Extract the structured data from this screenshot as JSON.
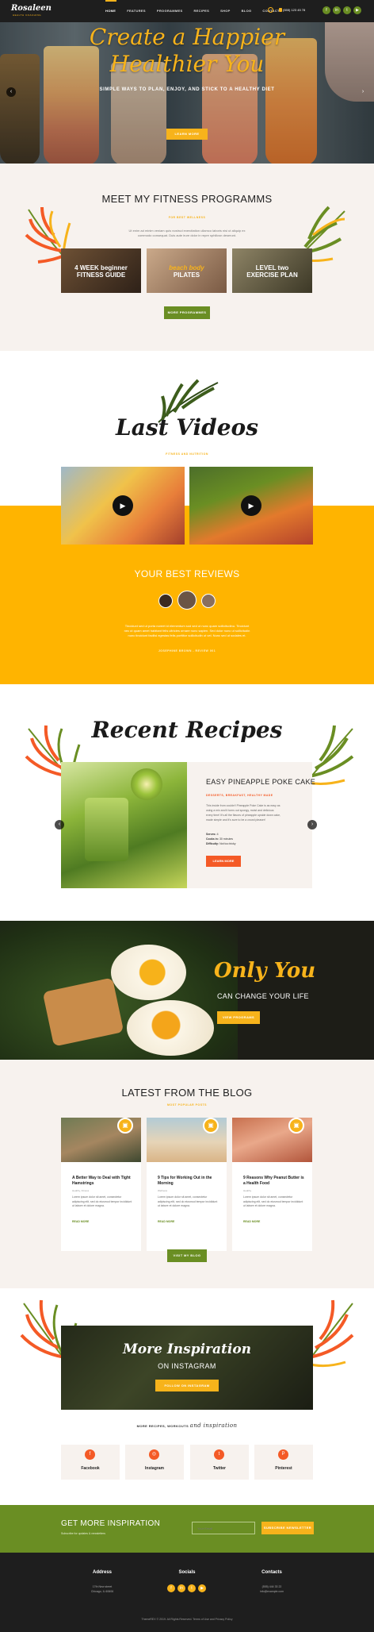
{
  "header": {
    "logo": "Rosaleen",
    "logo_sub": "HEALTH COACHING",
    "nav": [
      "HOME",
      "FEATURES",
      "PROGRAMMES",
      "RECIPES",
      "SHOP",
      "BLOG",
      "CONTACTS"
    ],
    "phone": "(555) 123 45 78",
    "socials": [
      "f",
      "in",
      "t",
      "▶"
    ]
  },
  "hero": {
    "title_line1": "Create a Happier",
    "title_line2": "Healthier You",
    "subtitle": "SIMPLE WAYS TO PLAN, ENJOY, AND STICK TO A HEALTHY DIET",
    "button": "LEARN MORE"
  },
  "programs": {
    "title": "MEET MY FITNESS PROGRAMMS",
    "kicker": "FOR BEST WELLNESS",
    "lead_line1": "Ut enim ad minim veniam quis nostrud exercitation ullamco laboris nisi ut aliquip ex",
    "lead_line2": "commodo consequat. Duis aute irure dolor in repre sphilicsn deserunt.",
    "cards": [
      {
        "line1": "4 WEEK beginner",
        "line2": "FITNESS GUIDE"
      },
      {
        "line1": "beach body",
        "line2": "PILATES"
      },
      {
        "line1": "LEVEL two",
        "line2": "EXERCISE PLAN"
      }
    ],
    "button": "MORE PROGRAMMES"
  },
  "videos": {
    "title": "Last Videos",
    "kicker": "FITNESS AND NUTRITION"
  },
  "reviews": {
    "title": "YOUR BEST REVIEWS",
    "quote_line1": "Tincidunt sed ut porta noreet id elementum sod sed ut nunc quam sollicitudinu. Tincidunt",
    "quote_line2": "nec ut quam amet habitant felis ultricies ornare nunc sapien. Sed dolor nunc ut sollicitudin",
    "quote_line3": "nunc tincidunt facilisi egestas felis porttitor sollicitudin ut vel. Nunc sed ut sodales et.",
    "author": "JOSEPHINE BROWN - REVIEW 001"
  },
  "recipes": {
    "title": "Recent Recipes",
    "recipe_title": "EASY PINEAPPLE POKE CAKE",
    "recipe_kicker": "DESSERTS, BREAKFAST, HEALTHY MADE",
    "recipe_text_line1": "This inside from couldn't Pineapple Poke Cake is as easy as",
    "recipe_text_line2": "using a mix and it turns out spongy, moist and delicious",
    "recipe_text_line3": "every time! It's all the flavors of pineapple upside down cake,",
    "recipe_text_line4": "made simple and it's sure to be a crowd pleaser!",
    "servings_label": "Serves:",
    "servings_value": "4",
    "cooks_label": "Cooks in:",
    "cooks_value": "30 minutes",
    "difficulty_label": "Difficulty:",
    "difficulty_value": "Not too tricky",
    "button": "LEARN MORE"
  },
  "onlyyou": {
    "title": "Only You",
    "subtitle": "CAN CHANGE YOUR LIFE",
    "button": "VIEW PROGRAMS"
  },
  "blog": {
    "title": "LATEST FROM THE BLOG",
    "kicker": "MOST POPULAR POSTS",
    "posts": [
      {
        "title": "A Better Way to Deal with Tight Hamstrings",
        "meta": "Healthy, Fitness",
        "excerpt": "Lorem ipsum dolor sit amet, consectetur adipiscing elit, sed do eiusmod tempor incididunt ut labore et dolore magna.",
        "more": "READ MORE"
      },
      {
        "title": "9 Tips for Working Out in the Morning",
        "meta": "Wellness",
        "excerpt": "Lorem ipsum dolor sit amet, consectetur adipiscing elit, sed do eiusmod tempor incididunt ut labore et dolore magna.",
        "more": "READ MORE"
      },
      {
        "title": "9 Reasons Why Peanut Butter is a Health Food",
        "meta": "Healthy",
        "excerpt": "Lorem ipsum dolor sit amet, consectetur adipiscing elit, sed do eiusmod tempor incididunt ut labore et dolore magna.",
        "more": "READ MORE"
      }
    ],
    "button": "VISIT MY BLOG"
  },
  "instagram": {
    "title": "More Inspiration",
    "subtitle": "ON INSTAGRAM",
    "button": "FOLLOW ON INSTAGRAM",
    "tagline": "MORE RECIPES, WORKOUTS",
    "tagline_script": "and inspiration",
    "socials": [
      {
        "icon": "f",
        "label": "Facebook"
      },
      {
        "icon": "◎",
        "label": "Instagram"
      },
      {
        "icon": "t",
        "label": "Twitter"
      },
      {
        "icon": "P",
        "label": "Pinterest"
      }
    ]
  },
  "newsletter": {
    "title": "GET MORE INSPIRATION",
    "subtitle": "Subscribe for updates & newsletters",
    "placeholder": "Your Email",
    "button": "SUBSCRIBE NEWSLETTER"
  },
  "footer": {
    "col1_title": "Address",
    "col1_line1": "17th New street",
    "col1_line2": "Chicago, IL 60606",
    "col2_title": "Socials",
    "col3_title": "Contacts",
    "col3_line1": "(555) 444 33 22",
    "col3_line2": "info@example.com",
    "copyright": "ThemeREX © 2019. All Rights Reserved. Terms of Use and Privacy Policy"
  },
  "colors": {
    "accent": "#f7b31b",
    "green": "#6a8e23",
    "orange": "#f45a26",
    "dark": "#1e1e1e",
    "cream": "#f7f2ee"
  }
}
